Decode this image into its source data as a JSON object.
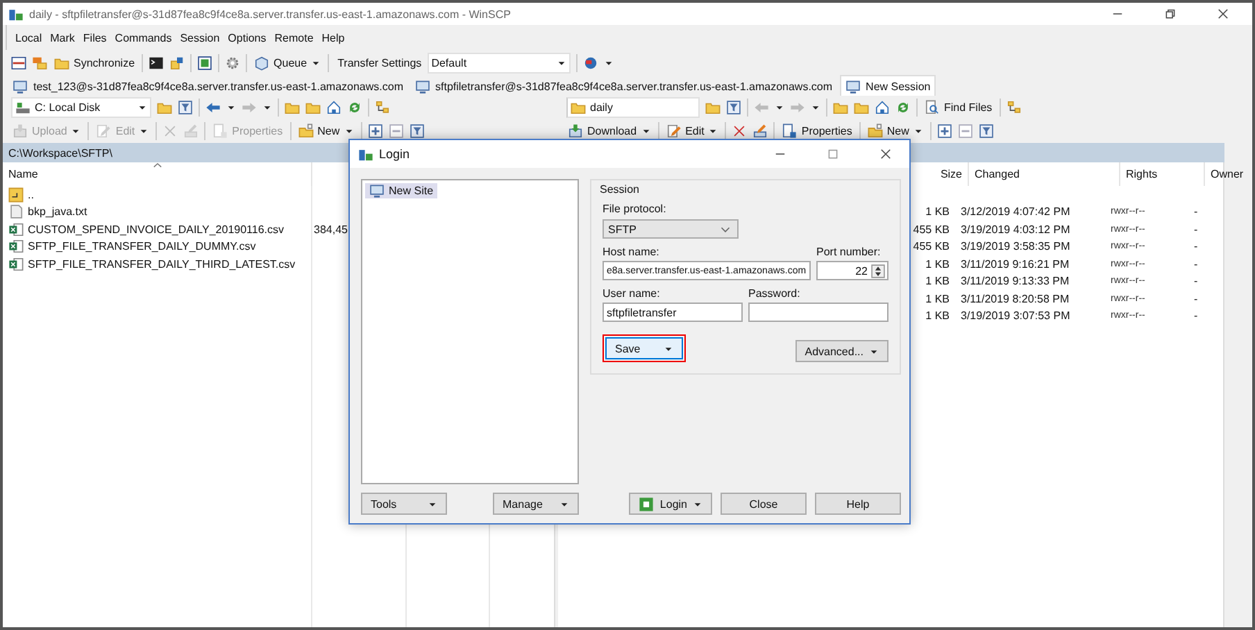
{
  "window": {
    "title": "daily - sftpfiletransfer@s-31d87fea8c9f4ce8a.server.transfer.us-east-1.amazonaws.com - WinSCP"
  },
  "menu": [
    "Local",
    "Mark",
    "Files",
    "Commands",
    "Session",
    "Options",
    "Remote",
    "Help"
  ],
  "toolbar": {
    "synchronize": "Synchronize",
    "queue": "Queue",
    "transfer_settings_label": "Transfer Settings",
    "transfer_settings_value": "Default"
  },
  "session_tabs": [
    {
      "label": "test_123@s-31d87fea8c9f4ce8a.server.transfer.us-east-1.amazonaws.com",
      "selected": false
    },
    {
      "label": "sftpfiletransfer@s-31d87fea8c9f4ce8a.server.transfer.us-east-1.amazonaws.com",
      "selected": false
    },
    {
      "label": "New Session",
      "selected": true
    }
  ],
  "local": {
    "drive": "C: Local Disk",
    "back_enabled": true,
    "actions": [
      {
        "kind": "split",
        "label": "Upload",
        "disabled": true
      },
      {
        "kind": "split",
        "label": "Edit",
        "disabled": true
      },
      {
        "kind": "delete",
        "disabled": true
      },
      {
        "kind": "rename",
        "disabled": true
      },
      {
        "kind": "button",
        "label": "Properties",
        "disabled": true
      },
      {
        "kind": "split",
        "label": "New",
        "disabled": false
      }
    ],
    "path": "C:\\Workspace\\SFTP\\",
    "columns": [
      "Name"
    ],
    "rows": [
      {
        "name": "..",
        "kind": "parent"
      },
      {
        "name": "bkp_java.txt",
        "kind": "text"
      },
      {
        "name": "CUSTOM_SPEND_INVOICE_DAILY_20190116.csv",
        "size": "384,45",
        "kind": "spreadsheet"
      },
      {
        "name": "SFTP_FILE_TRANSFER_DAILY_DUMMY.csv",
        "kind": "spreadsheet"
      },
      {
        "name": "SFTP_FILE_TRANSFER_DAILY_THIRD_LATEST.csv",
        "kind": "spreadsheet"
      }
    ]
  },
  "remote": {
    "directory": "daily",
    "find_files": "Find Files",
    "back_enabled": false,
    "actions": [
      {
        "kind": "split",
        "label": "Download",
        "disabled": false
      },
      {
        "kind": "split",
        "label": "Edit",
        "disabled": false
      },
      {
        "kind": "delete",
        "disabled": false
      },
      {
        "kind": "rename",
        "disabled": false
      },
      {
        "kind": "button",
        "label": "Properties",
        "disabled": false
      },
      {
        "kind": "split",
        "label": "New",
        "disabled": false
      }
    ],
    "columns": [
      "Size",
      "Changed",
      "Rights",
      "Owner"
    ],
    "rows": [
      {
        "size": "1 KB",
        "changed": "3/12/2019 4:07:42 PM",
        "rights": "rwxr--r--",
        "owner": "-"
      },
      {
        "size": "455 KB",
        "changed": "3/19/2019 4:03:12 PM",
        "rights": "rwxr--r--",
        "owner": "-"
      },
      {
        "size": "455 KB",
        "changed": "3/19/2019 3:58:35 PM",
        "rights": "rwxr--r--",
        "owner": "-"
      },
      {
        "size": "1 KB",
        "changed": "3/11/2019 9:16:21 PM",
        "rights": "rwxr--r--",
        "owner": "-"
      },
      {
        "size": "1 KB",
        "changed": "3/11/2019 9:13:33 PM",
        "rights": "rwxr--r--",
        "owner": "-"
      },
      {
        "size": "1 KB",
        "changed": "3/11/2019 8:20:58 PM",
        "rights": "rwxr--r--",
        "owner": "-"
      },
      {
        "size": "1 KB",
        "changed": "3/19/2019 3:07:53 PM",
        "rights": "rwxr--r--",
        "owner": "-"
      }
    ]
  },
  "login_dialog": {
    "title": "Login",
    "sites": [
      {
        "label": "New Site",
        "selected": true
      }
    ],
    "session_group": "Session",
    "file_protocol_label": "File protocol:",
    "file_protocol": "SFTP",
    "host_label": "Host name:",
    "host": "e8a.server.transfer.us-east-1.amazonaws.com",
    "port_label": "Port number:",
    "port": "22",
    "user_label": "User name:",
    "user": "sftpfiletransfer",
    "password_label": "Password:",
    "save": {
      "label": "Save",
      "highlighted": true
    },
    "advanced": "Advanced...",
    "tools": "Tools",
    "manage": "Manage",
    "login": "Login",
    "close": "Close",
    "help": "Help"
  }
}
